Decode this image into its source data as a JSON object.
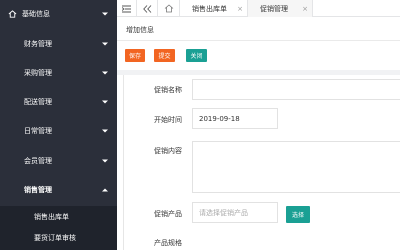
{
  "sidebar": {
    "items": [
      {
        "label": "基础信息"
      },
      {
        "label": "财务管理"
      },
      {
        "label": "采购管理"
      },
      {
        "label": "配送管理"
      },
      {
        "label": "日常管理"
      },
      {
        "label": "会员管理"
      },
      {
        "label": "销售管理"
      }
    ],
    "submenu": [
      {
        "label": "销售出库单"
      },
      {
        "label": "要货订单审核"
      }
    ]
  },
  "tabs": [
    {
      "label": "销售出库单",
      "close": "×"
    },
    {
      "label": "促销管理",
      "close": "×"
    }
  ],
  "breadcrumb": "增加信息",
  "toolbar": {
    "save_label": "保存",
    "submit_label": "提交",
    "close_label": "关闭"
  },
  "form": {
    "name_label": "促销名称",
    "name_value": "",
    "start_label": "开始时间",
    "start_value": "2019-09-18",
    "content_label": "促销内容",
    "product_label": "促销产品",
    "product_placeholder": "请选择促销产品",
    "select_label": "选择",
    "spec_label": "产品规格"
  },
  "colors": {
    "sidebar_bg": "#2b2f3a",
    "accent_orange": "#f26522",
    "accent_teal": "#1aa094"
  }
}
